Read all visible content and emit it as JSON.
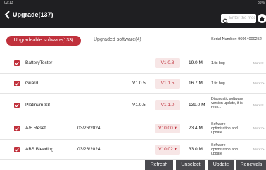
{
  "status": {
    "time": "02:13",
    "battery": "85%"
  },
  "header": {
    "title": "Upgrade(137)",
    "search_placeholder": "Enter the model n"
  },
  "tabs": {
    "active": "Upgradeable software(133)",
    "idle": "Upgraded software(4)",
    "serial": "Serial Number: 96064000252"
  },
  "rows": [
    {
      "name": "BatteryTester",
      "date": "",
      "current": "",
      "version": "V1.0.8",
      "size": "19.0 M",
      "desc": "1.fix bug",
      "more": "More>>"
    },
    {
      "name": "Guard",
      "date": "",
      "current": "V1.0.5",
      "version": "V1.1.5",
      "size": "16.7 M",
      "desc": "1.fix bug",
      "more": "More>>"
    },
    {
      "name": "Platinum S8",
      "date": "",
      "current": "V1.0.5",
      "version": "V1.1.0",
      "size": "139.0 M",
      "desc": "Diagnostic software version update, it is reco...",
      "more": "More>>"
    },
    {
      "name": "A/F Reset",
      "date": "03/26/2024",
      "current": "",
      "version": "V10.00 ▾",
      "size": "23.4 M",
      "desc": "Software optimization and update",
      "more": "More>>"
    },
    {
      "name": "ABS Bleeding",
      "date": "03/26/2024",
      "current": "",
      "version": "V10.02 ▾",
      "size": "33.0 M",
      "desc": "Software optimization and update",
      "more": "More>>"
    }
  ],
  "footer": {
    "refresh": "Refresh",
    "unselect": "Unselect",
    "update": "Update",
    "renewals": "Renewals"
  },
  "colors": {
    "accent": "#c0313c",
    "header_bg": "#1f1f22",
    "button_bg": "#4a4a4f"
  }
}
